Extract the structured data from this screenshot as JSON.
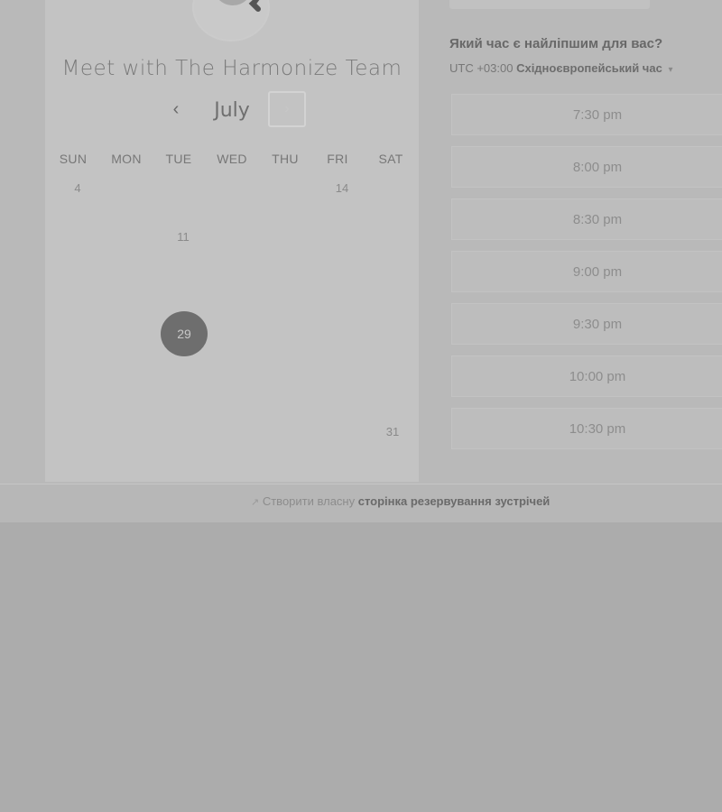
{
  "calendar": {
    "title": "Meet with The Harmonize Team",
    "month": "July",
    "prev_icon": "‹",
    "next_icon": "›",
    "weekdays": [
      "SUN",
      "MON",
      "TUE",
      "WED",
      "THU",
      "FRI",
      "SAT"
    ],
    "days": [
      "4",
      "14",
      "11",
      "31"
    ],
    "selected_day": "29"
  },
  "scheduler": {
    "question": "Який час є найліпшим для вас?",
    "timezone_offset": "UTC +03:00",
    "timezone_name": "Східноєвропейський час",
    "timezone_dropdown_icon": "▾",
    "slots": [
      "7:30 pm",
      "8:00 pm",
      "8:30 pm",
      "9:00 pm",
      "9:30 pm",
      "10:00 pm",
      "10:30 pm"
    ]
  },
  "footer": {
    "arrow_icon": "↗",
    "prefix": "Створити власну",
    "link": "сторінка резервування зустрічей"
  }
}
